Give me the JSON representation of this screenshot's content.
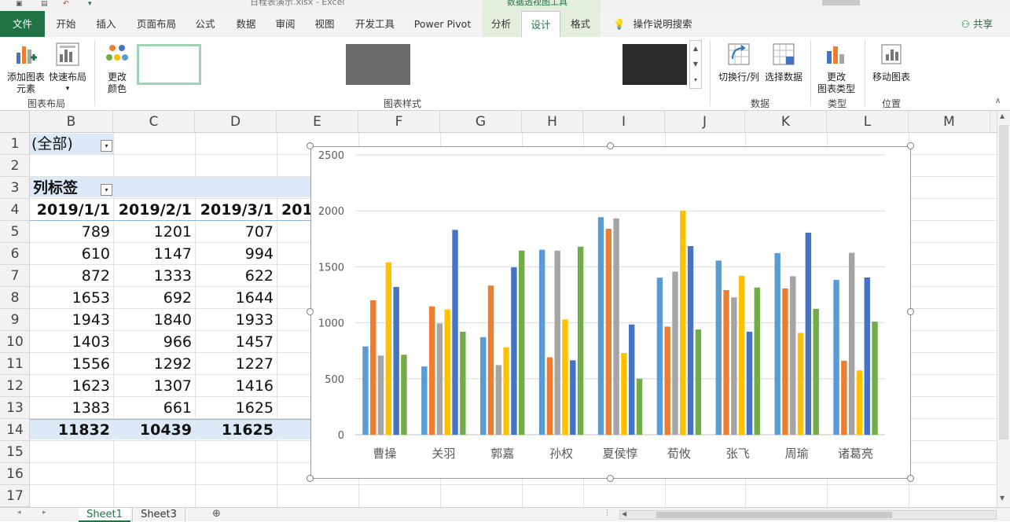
{
  "titlebar": {
    "filename": "日程表演示.xlsx  -  Excel",
    "context_title": "数据透视图工具"
  },
  "tabs": {
    "file": "文件",
    "home": "开始",
    "insert": "插入",
    "page_layout": "页面布局",
    "formulas": "公式",
    "data": "数据",
    "review": "审阅",
    "view": "视图",
    "developer": "开发工具",
    "power_pivot": "Power Pivot",
    "analyze": "分析",
    "design": "设计",
    "format": "格式",
    "tell_me": "操作说明搜索",
    "share": "共享"
  },
  "ribbon": {
    "add_element_1": "添加图表",
    "add_element_2": "元素",
    "quick_layout": "快速布局",
    "change_colors_1": "更改",
    "change_colors_2": "颜色",
    "group_layouts": "图表布局",
    "group_styles": "图表样式",
    "switch_row_col": "切换行/列",
    "select_data": "选择数据",
    "group_data": "数据",
    "change_type_1": "更改",
    "change_type_2": "图表类型",
    "group_type": "类型",
    "move_chart": "移动图表",
    "group_location": "位置"
  },
  "columns": [
    "B",
    "C",
    "D",
    "E",
    "F",
    "G",
    "H",
    "I",
    "J",
    "K",
    "L",
    "M"
  ],
  "rows": [
    "1",
    "2",
    "3",
    "4",
    "5",
    "6",
    "7",
    "8",
    "9",
    "10",
    "11",
    "12",
    "13",
    "14",
    "15",
    "16",
    "17"
  ],
  "pivot": {
    "filter_value": "(全部)",
    "col_label": "列标签",
    "headers": [
      "2019/1/1",
      "2019/2/1",
      "2019/3/1",
      "201"
    ],
    "col_b": [
      "789",
      "610",
      "872",
      "1653",
      "1943",
      "1403",
      "1556",
      "1623",
      "1383"
    ],
    "col_c": [
      "1201",
      "1147",
      "1333",
      "692",
      "1840",
      "966",
      "1292",
      "1307",
      "661"
    ],
    "col_d": [
      "707",
      "994",
      "622",
      "1644",
      "1933",
      "1457",
      "1227",
      "1416",
      "1625"
    ],
    "totals": [
      "11832",
      "10439",
      "11625"
    ]
  },
  "sheets": [
    "Sheet1",
    "Sheet3"
  ],
  "chart_data": {
    "type": "bar",
    "categories": [
      "曹操",
      "关羽",
      "郭嘉",
      "孙权",
      "夏侯惇",
      "荀攸",
      "张飞",
      "周瑜",
      "诸葛亮"
    ],
    "ylim": [
      0,
      2500
    ],
    "yticks": [
      "0",
      "500",
      "1000",
      "1500",
      "2000",
      "2500"
    ],
    "grid": true,
    "colors": [
      "#5b9bd5",
      "#ed7d31",
      "#a5a5a5",
      "#ffc000",
      "#4472c4",
      "#70ad47"
    ],
    "series": [
      {
        "values": [
          789,
          610,
          872,
          1653,
          1943,
          1403,
          1556,
          1623,
          1383
        ]
      },
      {
        "values": [
          1201,
          1147,
          1333,
          692,
          1840,
          966,
          1292,
          1307,
          661
        ]
      },
      {
        "values": [
          707,
          994,
          622,
          1644,
          1933,
          1457,
          1227,
          1416,
          1625
        ]
      },
      {
        "values": [
          1540,
          1120,
          780,
          1030,
          730,
          2000,
          1420,
          910,
          575
        ]
      },
      {
        "values": [
          1320,
          1830,
          1495,
          665,
          985,
          1685,
          920,
          1805,
          1405
        ]
      },
      {
        "values": [
          715,
          920,
          1645,
          1680,
          500,
          940,
          1315,
          1125,
          1010
        ]
      }
    ]
  }
}
